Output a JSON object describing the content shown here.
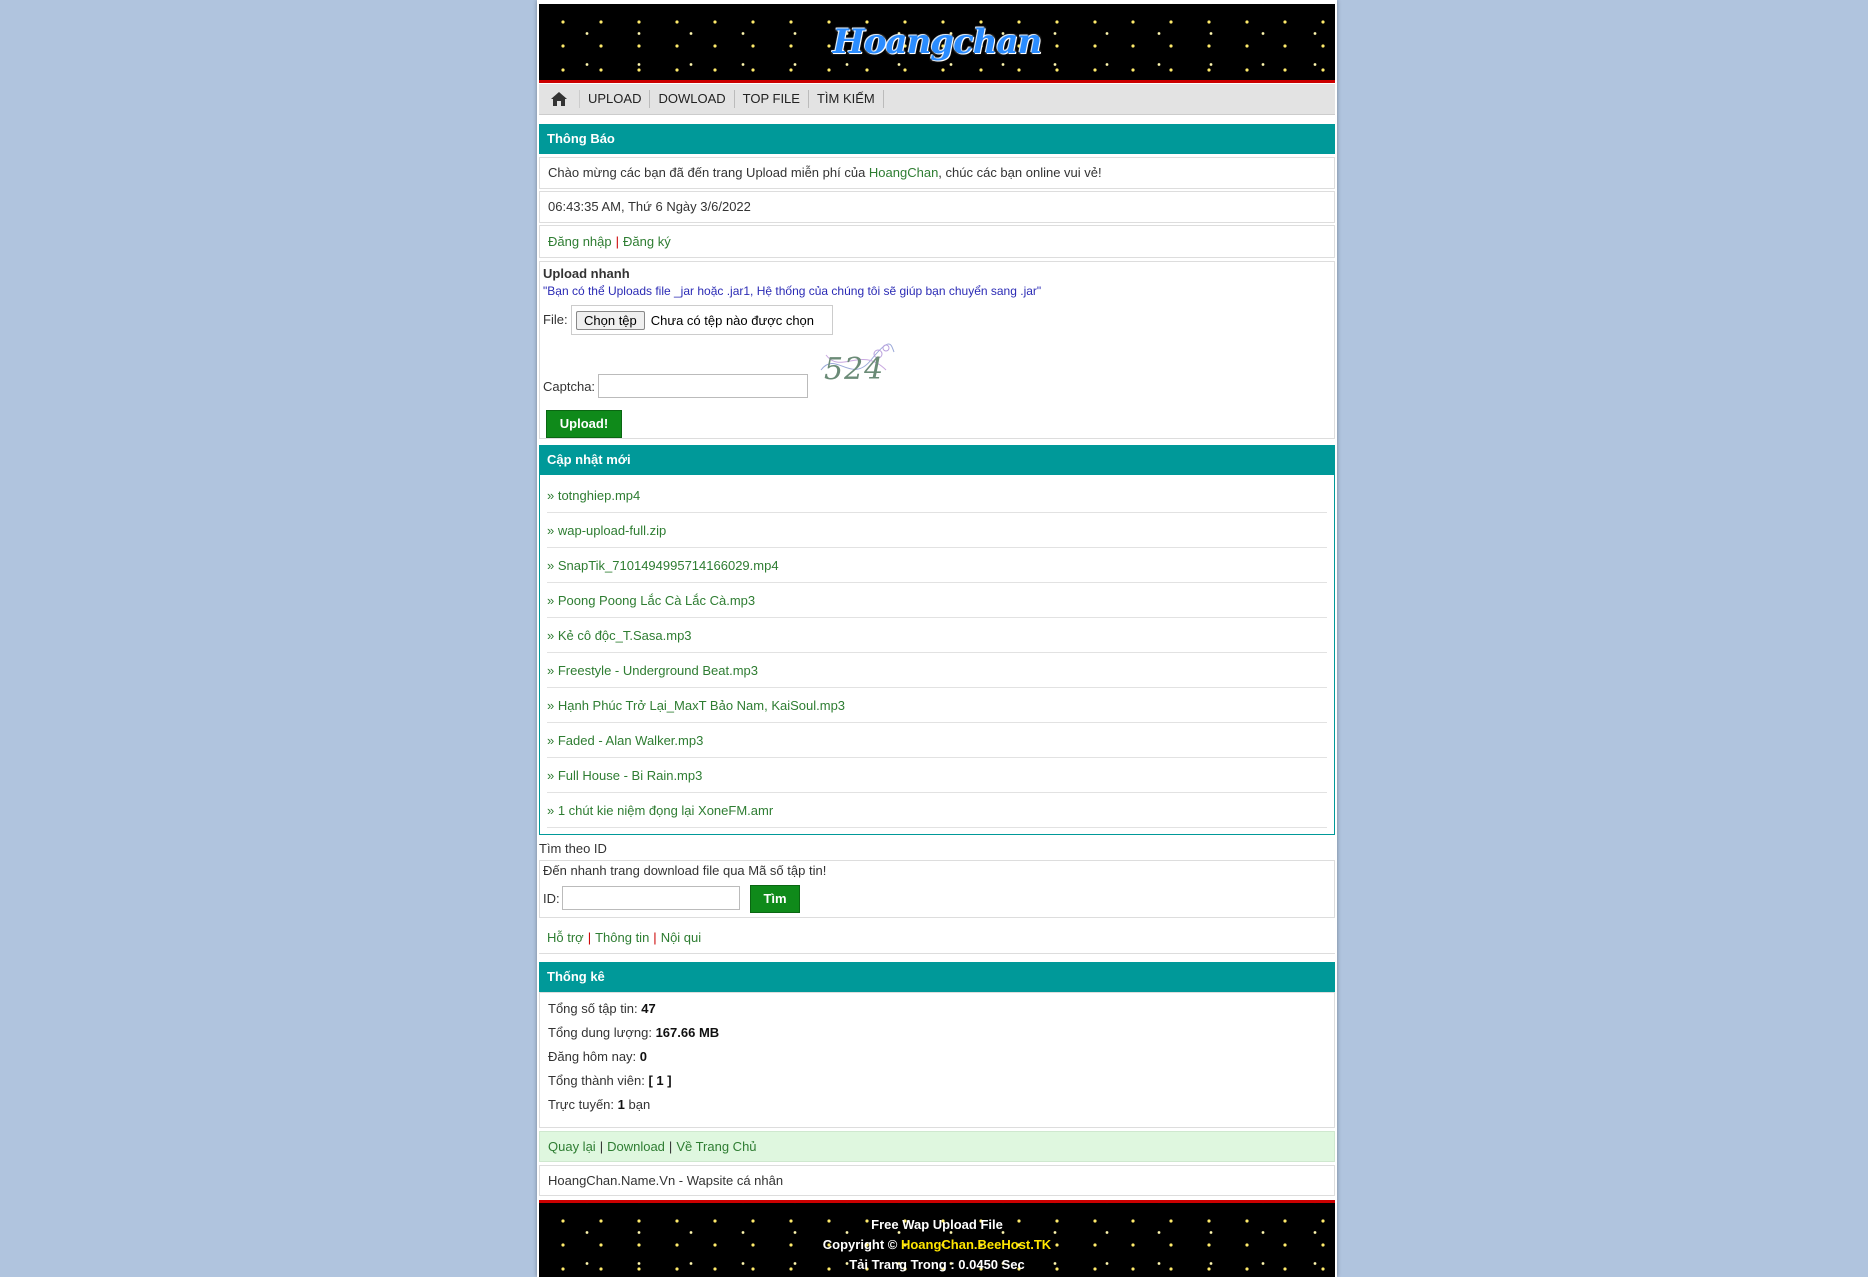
{
  "header": {
    "logo": "Hoangchan"
  },
  "nav": {
    "home_icon": "home-icon",
    "items": [
      "UPLOAD",
      "DOWLOAD",
      "TOP FILE",
      "TÌM KIẾM"
    ]
  },
  "notice": {
    "title": "Thông Báo",
    "welcome_prefix": "Chào mừng các bạn đã đến trang Upload miễn phí của ",
    "welcome_link": "HoangChan",
    "welcome_suffix": ", chúc các bạn online vui vẻ!",
    "datetime": "06:43:35 AM, Thứ 6 Ngày 3/6/2022",
    "login": "Đăng nhập",
    "register": "Đăng ký"
  },
  "upload": {
    "title": "Upload nhanh",
    "note": "\"Bạn có thể Uploads file _jar hoặc .jar1, Hệ thống của chúng tôi sẽ giúp bạn chuyển sang .jar\"",
    "file_label": "File:",
    "choose_button": "Chọn tệp",
    "no_file": "Chưa có tệp nào được chọn",
    "captcha_label": "Captcha:",
    "captcha_code": "524",
    "submit": "Upload!"
  },
  "updates": {
    "title": "Cập nhật mới",
    "items": [
      "» totnghiep.mp4",
      "» wap-upload-full.zip",
      "» SnapTik_7101494995714166029.mp4",
      "» Poong Poong Lắc Cà Lắc Cà.mp3",
      "» Kẻ cô độc_T.Sasa.mp3",
      "» Freestyle - Underground Beat.mp3",
      "» Hạnh Phúc Trở Lại_MaxT Bảo Nam, KaiSoul.mp3",
      "» Faded - Alan Walker.mp3",
      "» Full House - Bi Rain.mp3",
      "» 1 chút kie niệm đọng lại XoneFM.amr"
    ]
  },
  "search": {
    "title": "Tìm theo ID",
    "desc": "Đến nhanh trang download file qua Mã số tập tin!",
    "id_label": "ID:",
    "button": "Tìm"
  },
  "links": {
    "support": "Hỗ trợ",
    "info": "Thông tin",
    "rules": "Nội qui"
  },
  "stats": {
    "title": "Thống kê",
    "files_label": "Tổng số tập tin: ",
    "files_value": "47",
    "capacity_label": "Tổng dung lượng: ",
    "capacity_value": "167.66 MB",
    "today_label": "Đăng hôm nay: ",
    "today_value": "0",
    "members_label": "Tổng thành viên: ",
    "members_value": "[ 1 ]",
    "online_label": "Trực tuyến: ",
    "online_value": "1",
    "online_suffix": " bạn"
  },
  "footer_links": {
    "back": "Quay lại",
    "download": "Download",
    "home": "Về Trang Chủ"
  },
  "site_line": "HoangChan.Name.Vn - Wapsite cá nhân",
  "footer": {
    "line1": "Free Wap Upload File",
    "copyright_prefix": "Copyright © ",
    "copyright_site": "HoangChan.BeeHost.TK",
    "line3": "Tải Trang Trong : 0.0450 Sec"
  },
  "colors": {
    "teal": "#009999",
    "green_button": "#0f8a1a",
    "link": "#2e7d32",
    "separator": "#cc0000"
  }
}
